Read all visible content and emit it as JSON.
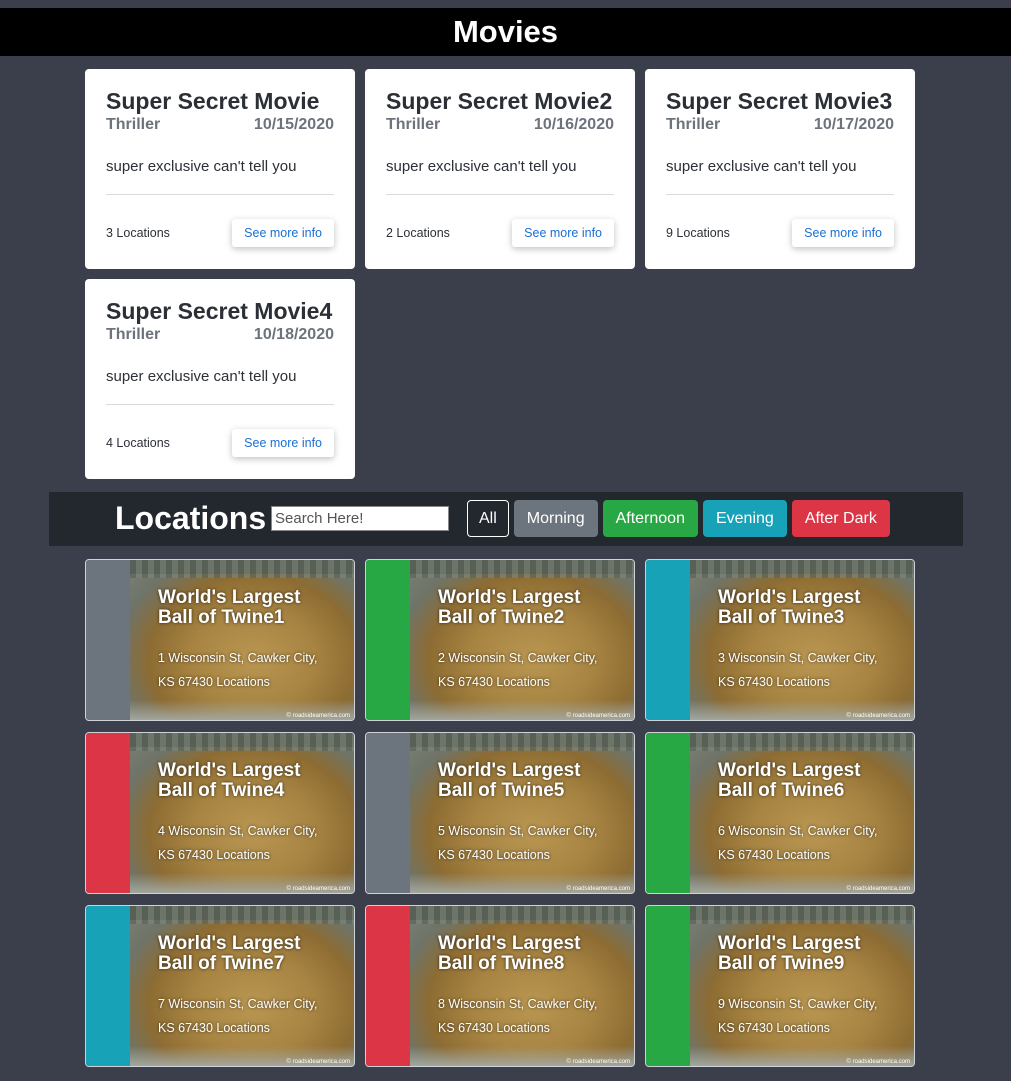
{
  "header": {
    "title": "Movies"
  },
  "movies": [
    {
      "title": "Super Secret Movie",
      "genre": "Thriller",
      "date": "10/15/2020",
      "description": "super exclusive can't tell you",
      "locations": "3 Locations",
      "button": "See more info"
    },
    {
      "title": "Super Secret Movie2",
      "genre": "Thriller",
      "date": "10/16/2020",
      "description": "super exclusive can't tell you",
      "locations": "2 Locations",
      "button": "See more info"
    },
    {
      "title": "Super Secret Movie3",
      "genre": "Thriller",
      "date": "10/17/2020",
      "description": "super exclusive can't tell you",
      "locations": "9 Locations",
      "button": "See more info"
    },
    {
      "title": "Super Secret Movie4",
      "genre": "Thriller",
      "date": "10/18/2020",
      "description": "super exclusive can't tell you",
      "locations": "4 Locations",
      "button": "See more info"
    }
  ],
  "locations_bar": {
    "title": "Locations",
    "search_placeholder": "Search Here!",
    "filters": [
      "All",
      "Morning",
      "Afternoon",
      "Evening",
      "After Dark"
    ]
  },
  "colors": {
    "gray": "#6c757d",
    "green": "#28a745",
    "teal": "#17a2b8",
    "red": "#dc3545"
  },
  "locations": [
    {
      "name_line1": "World's Largest",
      "name_line2": "Ball of Twine1",
      "addr_line1": "1 Wisconsin St, Cawker City,",
      "addr_line2": "KS 67430 Locations",
      "stripe": "#6c757d",
      "credit": "© roadsideamerica.com"
    },
    {
      "name_line1": "World's Largest",
      "name_line2": "Ball of Twine2",
      "addr_line1": "2 Wisconsin St, Cawker City,",
      "addr_line2": "KS 67430 Locations",
      "stripe": "#28a745",
      "credit": "© roadsideamerica.com"
    },
    {
      "name_line1": "World's Largest",
      "name_line2": "Ball of Twine3",
      "addr_line1": "3 Wisconsin St, Cawker City,",
      "addr_line2": "KS 67430 Locations",
      "stripe": "#17a2b8",
      "credit": "© roadsideamerica.com"
    },
    {
      "name_line1": "World's Largest",
      "name_line2": "Ball of Twine4",
      "addr_line1": "4 Wisconsin St, Cawker City,",
      "addr_line2": "KS 67430 Locations",
      "stripe": "#dc3545",
      "credit": "© roadsideamerica.com"
    },
    {
      "name_line1": "World's Largest",
      "name_line2": "Ball of Twine5",
      "addr_line1": "5 Wisconsin St, Cawker City,",
      "addr_line2": "KS 67430 Locations",
      "stripe": "#6c757d",
      "credit": "© roadsideamerica.com"
    },
    {
      "name_line1": "World's Largest",
      "name_line2": "Ball of Twine6",
      "addr_line1": "6 Wisconsin St, Cawker City,",
      "addr_line2": "KS 67430 Locations",
      "stripe": "#28a745",
      "credit": "© roadsideamerica.com"
    },
    {
      "name_line1": "World's Largest",
      "name_line2": "Ball of Twine7",
      "addr_line1": "7 Wisconsin St, Cawker City,",
      "addr_line2": "KS 67430 Locations",
      "stripe": "#17a2b8",
      "credit": "© roadsideamerica.com"
    },
    {
      "name_line1": "World's Largest",
      "name_line2": "Ball of Twine8",
      "addr_line1": "8 Wisconsin St, Cawker City,",
      "addr_line2": "KS 67430 Locations",
      "stripe": "#dc3545",
      "credit": "© roadsideamerica.com"
    },
    {
      "name_line1": "World's Largest",
      "name_line2": "Ball of Twine9",
      "addr_line1": "9 Wisconsin St, Cawker City,",
      "addr_line2": "KS 67430 Locations",
      "stripe": "#28a745",
      "credit": "© roadsideamerica.com"
    }
  ]
}
